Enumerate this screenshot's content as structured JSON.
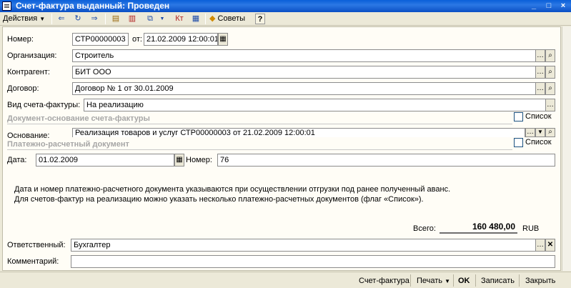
{
  "window": {
    "title": "Счет-фактура выданный: Проведен",
    "controls": [
      "_",
      "□",
      "×"
    ]
  },
  "toolbar": {
    "actions_label": "Действия",
    "advice_label": "Советы",
    "help_label": "?"
  },
  "header": {
    "number_label": "Номер:",
    "number_value": "СТР00000003",
    "date_from_label": "от:",
    "date_value": "21.02.2009 12:00:01",
    "organization_label": "Организация:",
    "organization_value": "Строитель",
    "contractor_label": "Контрагент:",
    "contractor_value": "БИТ ООО",
    "contract_label": "Договор:",
    "contract_value": "Договор № 1 от 30.01.2009",
    "invoice_type_label": "Вид счета-фактуры:",
    "invoice_type_value": "На реализацию"
  },
  "basis_section": {
    "title": "Документ-основание счета-фактуры",
    "list_label": "Список",
    "basis_label": "Основание:",
    "basis_value": "Реализация товаров и услуг СТР00000003 от 21.02.2009 12:00:01"
  },
  "payment_section": {
    "title": "Платежно-расчетный документ",
    "list_label": "Список",
    "date_label": "Дата:",
    "date_value": "01.02.2009",
    "number_label": "Номер:",
    "number_value": "76"
  },
  "notes": {
    "line1": "Дата и номер платежно-расчетного документа указываются при осуществлении отгрузки под ранее полученный аванс.",
    "line2": "Для счетов-фактур на реализацию можно указать несколько платежно-расчетных документов (флаг «Список»)."
  },
  "total": {
    "label": "Всего:",
    "value": "160 480,00",
    "currency": "RUB"
  },
  "footer": {
    "responsible_label": "Ответственный:",
    "responsible_value": "Бухгалтер",
    "comment_label": "Комментарий:",
    "comment_value": ""
  },
  "bottom_bar": {
    "invoice_button": "Счет-фактура",
    "print_button": "Печать",
    "ok_button": "OK",
    "save_button": "Записать",
    "close_button": "Закрыть"
  }
}
